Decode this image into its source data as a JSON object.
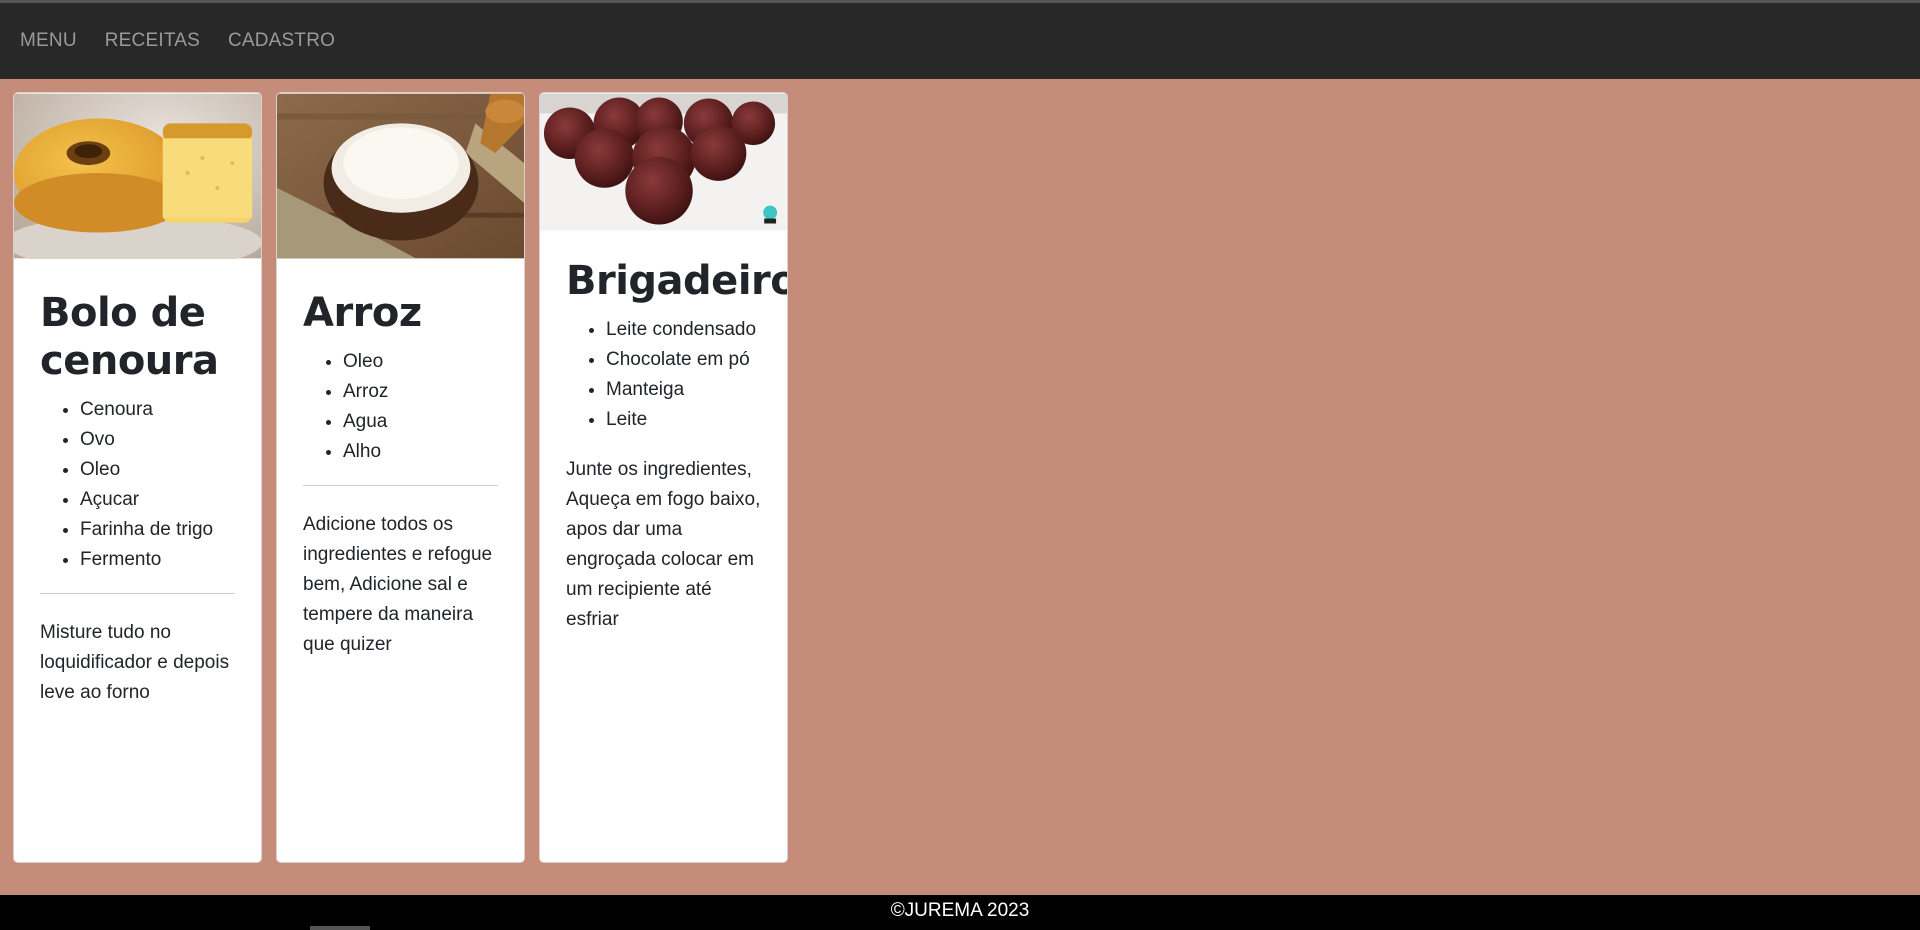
{
  "nav": {
    "items": [
      "MENU",
      "RECEITAS",
      "CADASTRO"
    ]
  },
  "recipes": [
    {
      "title": "Bolo de cenoura",
      "image_icon": "cake-photo",
      "ingredients": [
        "Cenoura",
        "Ovo",
        "Oleo",
        "Açucar",
        "Farinha de trigo",
        "Fermento"
      ],
      "description": "Misture tudo no loquidificador e depois leve ao forno"
    },
    {
      "title": "Arroz",
      "image_icon": "rice-photo",
      "ingredients": [
        "Oleo",
        "Arroz",
        "Agua",
        "Alho"
      ],
      "description": "Adicione todos os ingredientes e refogue bem, Adicione sal e tempere da maneira que quizer"
    },
    {
      "title": "Brigadeiro",
      "image_icon": "brigadeiro-photo",
      "ingredients": [
        "Leite condensado",
        "Chocolate em pó",
        "Manteiga",
        "Leite"
      ],
      "description": "Junte os ingredientes, Aqueça em fogo baixo, apos dar uma engroçada colocar em um recipiente até esfriar"
    }
  ],
  "footer": {
    "text": "©JUREMA 2023"
  },
  "colors": {
    "page_bg": "#c58c7a",
    "navbar_bg": "#282828",
    "nav_text": "#9a9a9a",
    "footer_bg": "#000000"
  }
}
